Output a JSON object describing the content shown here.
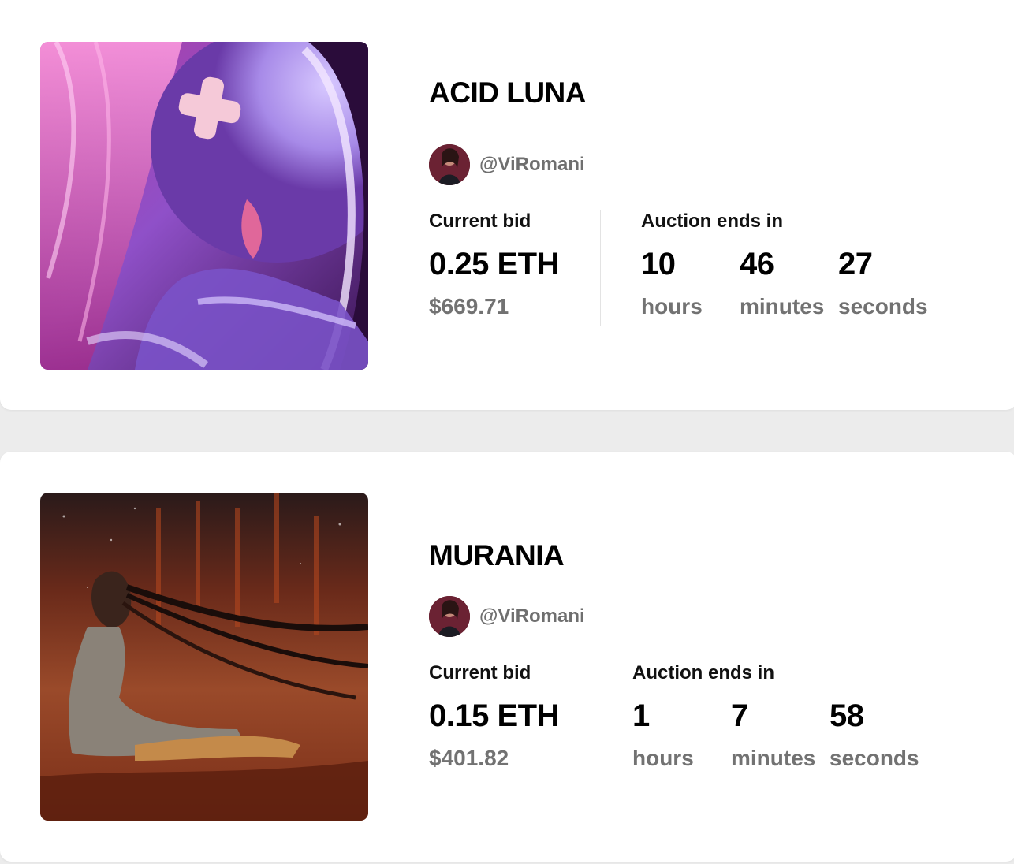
{
  "auctions": [
    {
      "title": "ACID LUNA",
      "creator_handle": "@ViRomani",
      "current_bid_label": "Current bid",
      "current_bid_eth": "0.25 ETH",
      "current_bid_usd": "$669.71",
      "auction_ends_label": "Auction ends in",
      "countdown": {
        "hours_value": "10",
        "hours_label": "hours",
        "minutes_value": "46",
        "minutes_label": "minutes",
        "seconds_value": "27",
        "seconds_label": "seconds"
      }
    },
    {
      "title": "MURANIA",
      "creator_handle": "@ViRomani",
      "current_bid_label": "Current bid",
      "current_bid_eth": "0.15 ETH",
      "current_bid_usd": "$401.82",
      "auction_ends_label": "Auction ends in",
      "countdown": {
        "hours_value": "1",
        "hours_label": "hours",
        "minutes_value": "7",
        "minutes_label": "minutes",
        "seconds_value": "58",
        "seconds_label": "seconds"
      }
    }
  ],
  "colors": {
    "page_background": "#ececec",
    "card_background": "#ffffff",
    "muted_text": "#727272"
  }
}
